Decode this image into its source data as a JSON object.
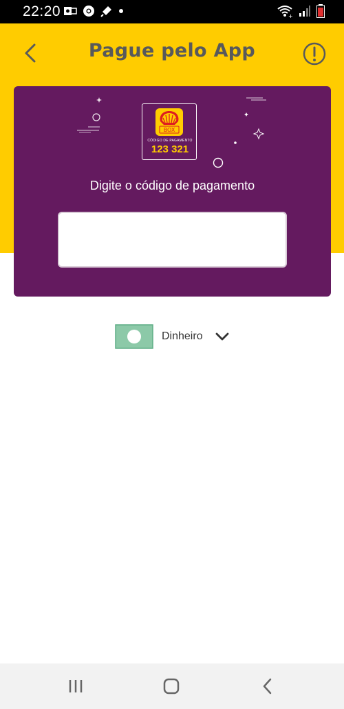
{
  "status_bar": {
    "time": "22:20"
  },
  "header": {
    "title": "Pague pelo App",
    "back_icon": "chevron-left-icon",
    "info_icon": "alert-circle-icon"
  },
  "card": {
    "logo": {
      "brand_text": "BOX",
      "caption": "CÓDIGO DE PAGAMENTO",
      "code": "123 321"
    },
    "label": "Digite o código de pagamento",
    "input_value": "",
    "input_placeholder": ""
  },
  "payment": {
    "method_label": "Dinheiro",
    "icon": "money-bill-icon"
  },
  "colors": {
    "yellow": "#FFCC00",
    "purple": "#641A5F",
    "title_gray": "#58595B",
    "money_green": "#8CC9A8"
  }
}
